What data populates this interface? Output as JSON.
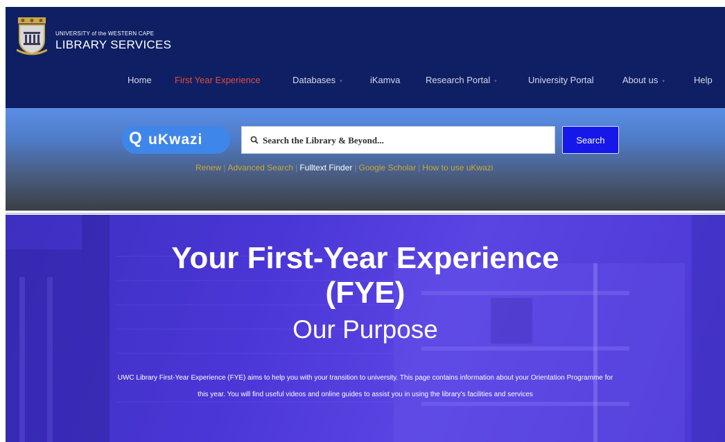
{
  "header": {
    "university_name": "UNIVERSITY of the WESTERN CAPE",
    "service_name": "LIBRARY SERVICES",
    "logo_icon": "uwc-crest-icon"
  },
  "nav": {
    "items": [
      {
        "label": "Home",
        "dropdown": false
      },
      {
        "label": "First Year Experience",
        "dropdown": false,
        "active": true
      },
      {
        "label": "Databases",
        "dropdown": true
      },
      {
        "label": "iKamva",
        "dropdown": false
      },
      {
        "label": "Research Portal",
        "dropdown": true
      },
      {
        "label": "University Portal",
        "dropdown": false
      },
      {
        "label": "About us",
        "dropdown": true
      },
      {
        "label": "Help",
        "dropdown": false
      }
    ],
    "caret_glyph": "▾"
  },
  "search": {
    "brand_q": "Q",
    "brand": "uKwazi",
    "placeholder": "Search the Library & Beyond...",
    "button_label": "Search",
    "links": [
      "Renew",
      "Advanced Search",
      "Fulltext Finder",
      "Google Scholar",
      "How to use uKwazi"
    ],
    "separator": "|"
  },
  "hero": {
    "title_line1": "Your First-Year Experience",
    "title_line2": "(FYE)",
    "subtitle": "Our Purpose",
    "description": "UWC Library First-Year Experience (FYE) aims to help you with your transition to university. This page contains information about your Orientation Programme for this year.  You will find useful videos and online guides to assist you in using the library's facilities and services"
  },
  "colors": {
    "header_bg": "#0f1f63",
    "nav_active": "#e84a3c",
    "search_button": "#1518e8",
    "quick_link": "#c9a83c",
    "hero_bg": "#4a36d6"
  }
}
